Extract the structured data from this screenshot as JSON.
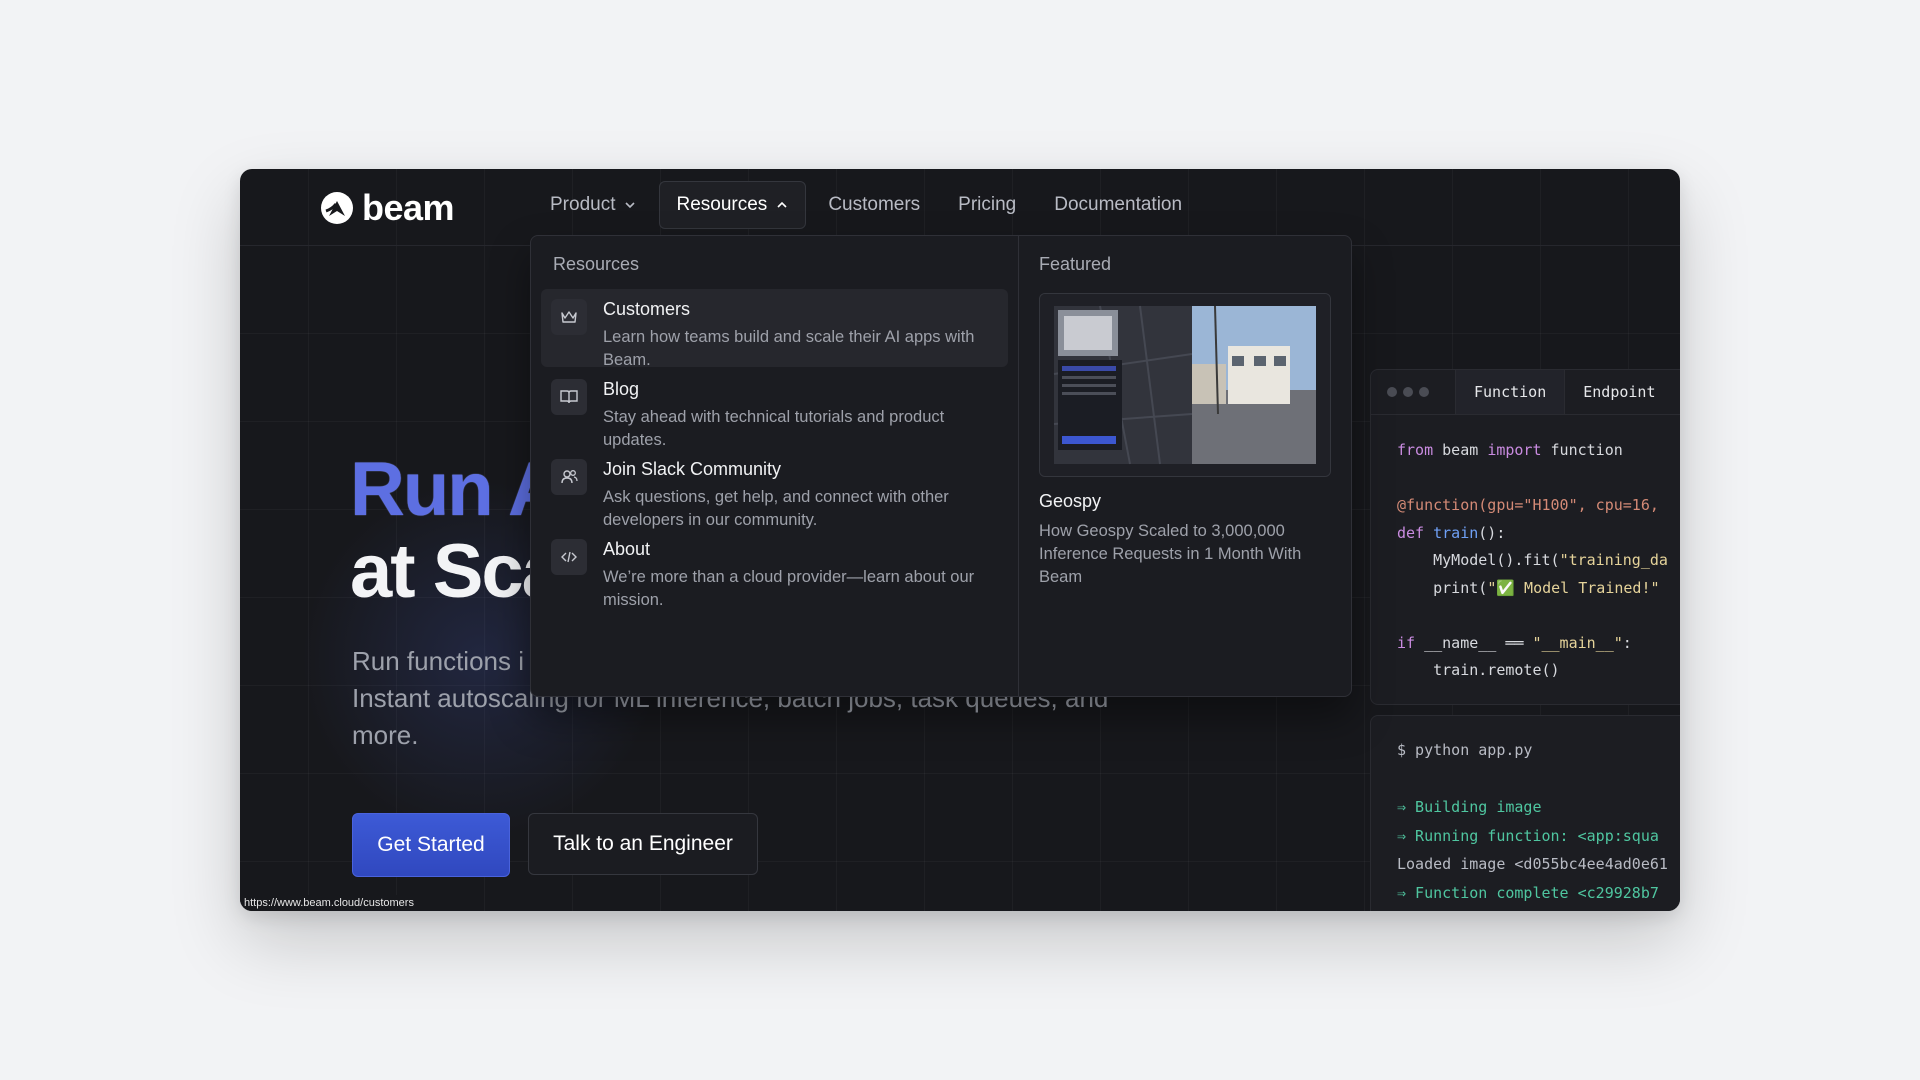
{
  "brand": {
    "name": "beam"
  },
  "nav": {
    "items": [
      {
        "label": "Product",
        "has_chevron": true,
        "expanded": false
      },
      {
        "label": "Resources",
        "has_chevron": true,
        "expanded": true
      },
      {
        "label": "Customers"
      },
      {
        "label": "Pricing"
      },
      {
        "label": "Documentation"
      }
    ]
  },
  "dropdown": {
    "resources_heading": "Resources",
    "items": [
      {
        "icon": "crown-icon",
        "title": "Customers",
        "description": "Learn how teams build and scale their AI apps with Beam."
      },
      {
        "icon": "book-icon",
        "title": "Blog",
        "description": "Stay ahead with technical tutorials and product updates."
      },
      {
        "icon": "users-icon",
        "title": "Join Slack Community",
        "description": "Ask questions, get help, and connect with other developers in our community."
      },
      {
        "icon": "code-icon",
        "title": "About",
        "description": "We’re more than a cloud provider—learn about our mission."
      }
    ],
    "featured_heading": "Featured",
    "featured": {
      "title": "Geospy",
      "description": "How Geospy Scaled to 3,000,000 Inference Requests in 1 Month With Beam"
    }
  },
  "hero": {
    "line1": "Run A",
    "line2": "at Sca",
    "subtitle_line1": "Run functions i",
    "subtitle_rest": "Instant autoscaling for ML inference, batch jobs, task queues, and more.",
    "primary_button": "Get Started",
    "secondary_button": "Talk to an Engineer"
  },
  "code_panel": {
    "tabs": [
      "Function",
      "Endpoint"
    ],
    "active_tab": "Function",
    "lines": {
      "l1a": "from",
      "l1b": " beam ",
      "l1c": "import",
      "l1d": " function",
      "l2": "@function(gpu=\"H100\", cpu=16,",
      "l3a": "def ",
      "l3b": "train",
      "l3c": "():",
      "l4a": "    MyModel().fit(",
      "l4b": "\"training_da",
      "l5a": "    print(",
      "l5b": "\"✅ Model Trained!\"",
      "l6a": "if",
      "l6b": " __name__ ══ ",
      "l6c": "\"__main__\"",
      "l6d": ":",
      "l7": "    train.remote()"
    }
  },
  "terminal": {
    "command": "$ python app.py",
    "lines": [
      {
        "text": "⇒ Building image",
        "ok": true
      },
      {
        "text": "⇒ Running function: <app:squa",
        "ok": true
      },
      {
        "text": "Loaded image <d055bc4ee4ad0e61",
        "ok": false
      },
      {
        "text": "⇒ Function complete <c29928b7",
        "ok": true
      }
    ]
  },
  "status_bar_url": "https://www.beam.cloud/customers"
}
